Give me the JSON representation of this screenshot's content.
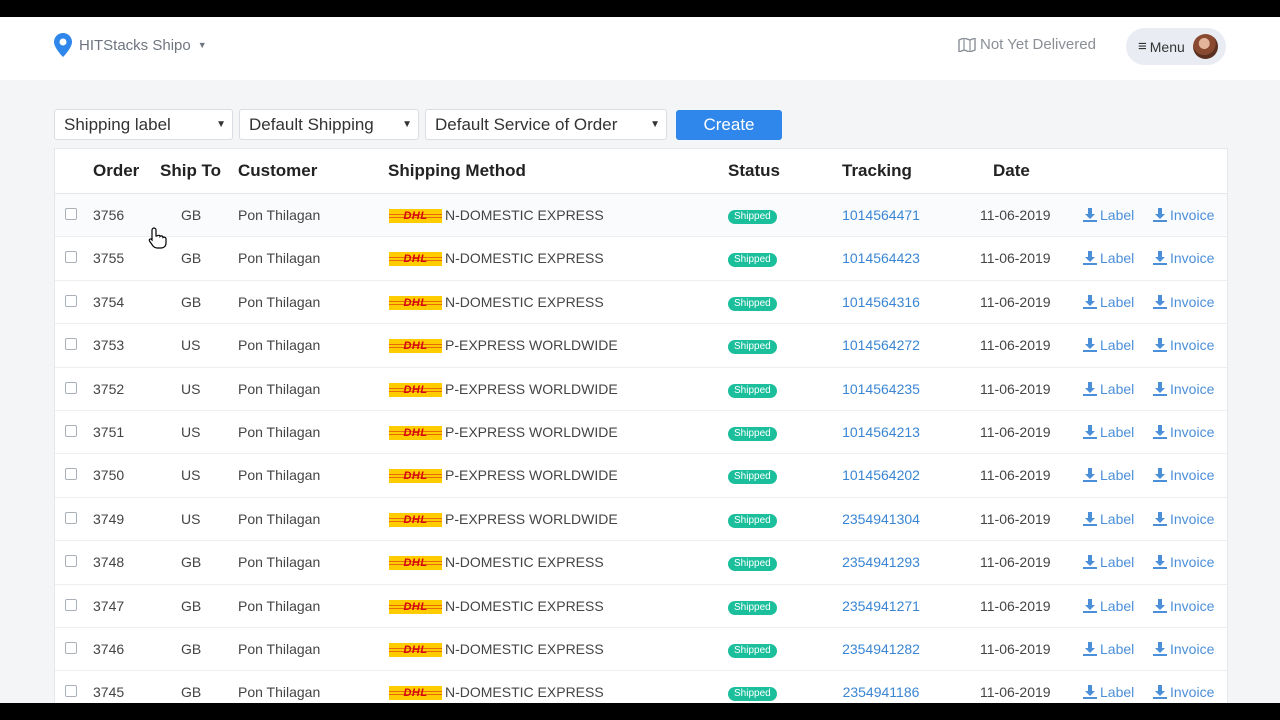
{
  "header": {
    "brand": "HITStacks Shipo",
    "status_filter": "Not Yet Delivered",
    "menu_label": "Menu"
  },
  "toolbar": {
    "select_1": "Shipping label",
    "select_2": "Default Shipping",
    "select_3": "Default Service of Order",
    "create_label": "Create"
  },
  "table": {
    "columns": [
      "Order",
      "Ship To",
      "Customer",
      "Shipping Method",
      "Status",
      "Tracking",
      "Date"
    ],
    "action_label": "Label",
    "action_invoice": "Invoice",
    "rows": [
      {
        "order": "3756",
        "ship_to": "GB",
        "customer": "Pon Thilagan",
        "carrier": "DHL",
        "method": "N-DOMESTIC EXPRESS",
        "status": "Shipped",
        "tracking": "1014564471",
        "date": "11-06-2019"
      },
      {
        "order": "3755",
        "ship_to": "GB",
        "customer": "Pon Thilagan",
        "carrier": "DHL",
        "method": "N-DOMESTIC EXPRESS",
        "status": "Shipped",
        "tracking": "1014564423",
        "date": "11-06-2019"
      },
      {
        "order": "3754",
        "ship_to": "GB",
        "customer": "Pon Thilagan",
        "carrier": "DHL",
        "method": "N-DOMESTIC EXPRESS",
        "status": "Shipped",
        "tracking": "1014564316",
        "date": "11-06-2019"
      },
      {
        "order": "3753",
        "ship_to": "US",
        "customer": "Pon Thilagan",
        "carrier": "DHL",
        "method": "P-EXPRESS WORLDWIDE",
        "status": "Shipped",
        "tracking": "1014564272",
        "date": "11-06-2019"
      },
      {
        "order": "3752",
        "ship_to": "US",
        "customer": "Pon Thilagan",
        "carrier": "DHL",
        "method": "P-EXPRESS WORLDWIDE",
        "status": "Shipped",
        "tracking": "1014564235",
        "date": "11-06-2019"
      },
      {
        "order": "3751",
        "ship_to": "US",
        "customer": "Pon Thilagan",
        "carrier": "DHL",
        "method": "P-EXPRESS WORLDWIDE",
        "status": "Shipped",
        "tracking": "1014564213",
        "date": "11-06-2019"
      },
      {
        "order": "3750",
        "ship_to": "US",
        "customer": "Pon Thilagan",
        "carrier": "DHL",
        "method": "P-EXPRESS WORLDWIDE",
        "status": "Shipped",
        "tracking": "1014564202",
        "date": "11-06-2019"
      },
      {
        "order": "3749",
        "ship_to": "US",
        "customer": "Pon Thilagan",
        "carrier": "DHL",
        "method": "P-EXPRESS WORLDWIDE",
        "status": "Shipped",
        "tracking": "2354941304",
        "date": "11-06-2019"
      },
      {
        "order": "3748",
        "ship_to": "GB",
        "customer": "Pon Thilagan",
        "carrier": "DHL",
        "method": "N-DOMESTIC EXPRESS",
        "status": "Shipped",
        "tracking": "2354941293",
        "date": "11-06-2019"
      },
      {
        "order": "3747",
        "ship_to": "GB",
        "customer": "Pon Thilagan",
        "carrier": "DHL",
        "method": "N-DOMESTIC EXPRESS",
        "status": "Shipped",
        "tracking": "2354941271",
        "date": "11-06-2019"
      },
      {
        "order": "3746",
        "ship_to": "GB",
        "customer": "Pon Thilagan",
        "carrier": "DHL",
        "method": "N-DOMESTIC EXPRESS",
        "status": "Shipped",
        "tracking": "2354941282",
        "date": "11-06-2019"
      },
      {
        "order": "3745",
        "ship_to": "GB",
        "customer": "Pon Thilagan",
        "carrier": "DHL",
        "method": "N-DOMESTIC EXPRESS",
        "status": "Shipped",
        "tracking": "2354941186",
        "date": "11-06-2019"
      }
    ]
  },
  "icons": {
    "brand": "map-pin-icon",
    "status_filter": "map-icon",
    "menu": "bars-icon",
    "actions": "download-icon",
    "pointer": "hand-cursor-icon"
  },
  "colors": {
    "primary": "#2f86eb",
    "status_shipped": "#1cbf9c",
    "link": "#3a86d4",
    "dhl_yellow": "#ffcc00",
    "dhl_red": "#d40511"
  }
}
